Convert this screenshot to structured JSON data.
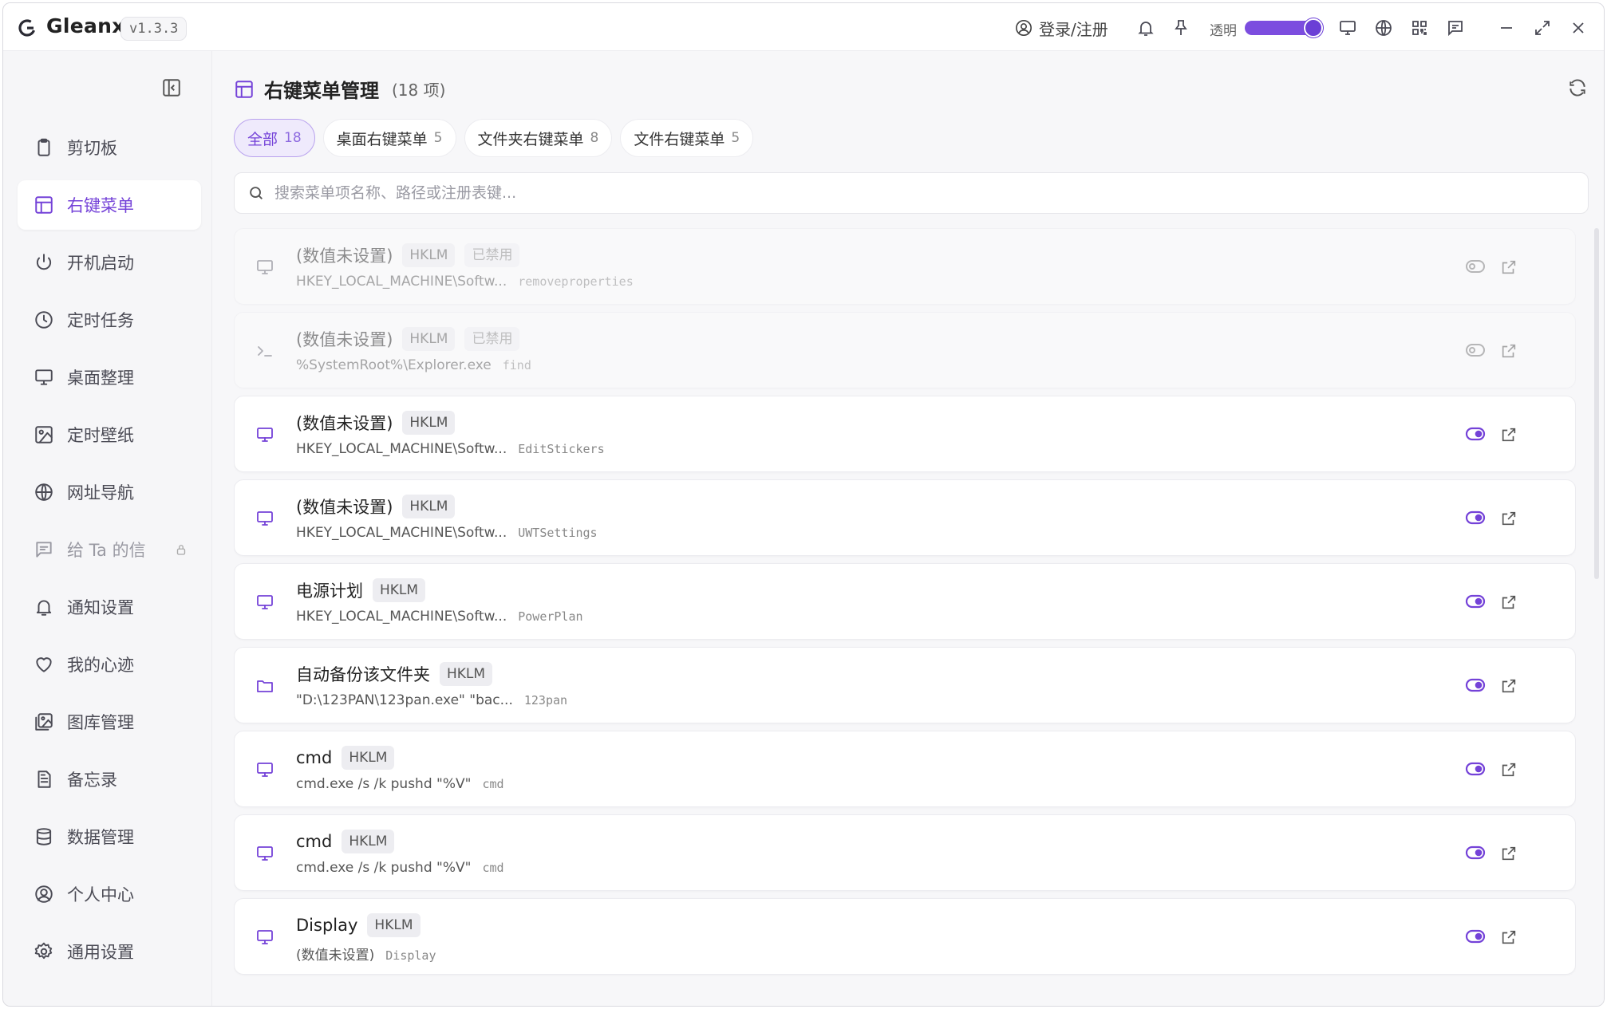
{
  "titlebar": {
    "app_name": "Gleanx",
    "version": "v1.3.3",
    "login": "登录/注册",
    "opacity_label": "透明",
    "opacity_value": 1.0
  },
  "sidebar": {
    "items": [
      {
        "label": "剪切板",
        "icon": "clipboard-icon"
      },
      {
        "label": "右键菜单",
        "icon": "layout-icon",
        "active": true
      },
      {
        "label": "开机启动",
        "icon": "power-icon"
      },
      {
        "label": "定时任务",
        "icon": "clock-icon"
      },
      {
        "label": "桌面整理",
        "icon": "monitor-icon"
      },
      {
        "label": "定时壁纸",
        "icon": "image-icon"
      },
      {
        "label": "网址导航",
        "icon": "globe-icon"
      },
      {
        "label": "给 Ta 的信",
        "icon": "message-icon",
        "locked": true
      },
      {
        "label": "通知设置",
        "icon": "bell-icon"
      },
      {
        "label": "我的心迹",
        "icon": "heart-icon"
      },
      {
        "label": "图库管理",
        "icon": "gallery-icon"
      },
      {
        "label": "备忘录",
        "icon": "memo-icon"
      },
      {
        "label": "数据管理",
        "icon": "database-icon"
      },
      {
        "label": "个人中心",
        "icon": "user-icon"
      },
      {
        "label": "通用设置",
        "icon": "gear-icon"
      }
    ]
  },
  "main": {
    "title": "右键菜单管理",
    "count": "(18 项)",
    "tabs": [
      {
        "label": "全部",
        "count": "18",
        "active": true
      },
      {
        "label": "桌面右键菜单",
        "count": "5"
      },
      {
        "label": "文件夹右键菜单",
        "count": "8"
      },
      {
        "label": "文件右键菜单",
        "count": "5"
      }
    ],
    "search_placeholder": "搜索菜单项名称、路径或注册表键...",
    "items": [
      {
        "name": "(数值未设置)",
        "badge": "HKLM",
        "status": "已禁用",
        "path": "HKEY_LOCAL_MACHINE\\Softw...",
        "key": "removeproperties",
        "icon": "monitor-icon",
        "enabled": false
      },
      {
        "name": "(数值未设置)",
        "badge": "HKLM",
        "status": "已禁用",
        "path": "%SystemRoot%\\Explorer.exe",
        "key": "find",
        "icon": "terminal-icon",
        "enabled": false
      },
      {
        "name": "(数值未设置)",
        "badge": "HKLM",
        "path": "HKEY_LOCAL_MACHINE\\Softw...",
        "key": "EditStickers",
        "icon": "monitor-icon",
        "enabled": true
      },
      {
        "name": "(数值未设置)",
        "badge": "HKLM",
        "path": "HKEY_LOCAL_MACHINE\\Softw...",
        "key": "UWTSettings",
        "icon": "monitor-icon",
        "enabled": true
      },
      {
        "name": "电源计划",
        "badge": "HKLM",
        "path": "HKEY_LOCAL_MACHINE\\Softw...",
        "key": "PowerPlan",
        "icon": "monitor-icon",
        "enabled": true
      },
      {
        "name": "自动备份该文件夹",
        "badge": "HKLM",
        "path": "\"D:\\123PAN\\123pan.exe\" \"bac...",
        "key": "123pan",
        "icon": "folder-icon",
        "enabled": true
      },
      {
        "name": "cmd",
        "badge": "HKLM",
        "path": "cmd.exe /s /k pushd \"%V\"",
        "key": "cmd",
        "icon": "monitor-icon",
        "enabled": true
      },
      {
        "name": "cmd",
        "badge": "HKLM",
        "path": "cmd.exe /s /k pushd \"%V\"",
        "key": "cmd",
        "icon": "monitor-icon",
        "enabled": true
      },
      {
        "name": "Display",
        "badge": "HKLM",
        "path": "(数值未设置)",
        "key": "Display",
        "icon": "monitor-icon",
        "enabled": true
      }
    ]
  },
  "colors": {
    "accent": "#7442d8",
    "accent_light": "#efeafc"
  }
}
